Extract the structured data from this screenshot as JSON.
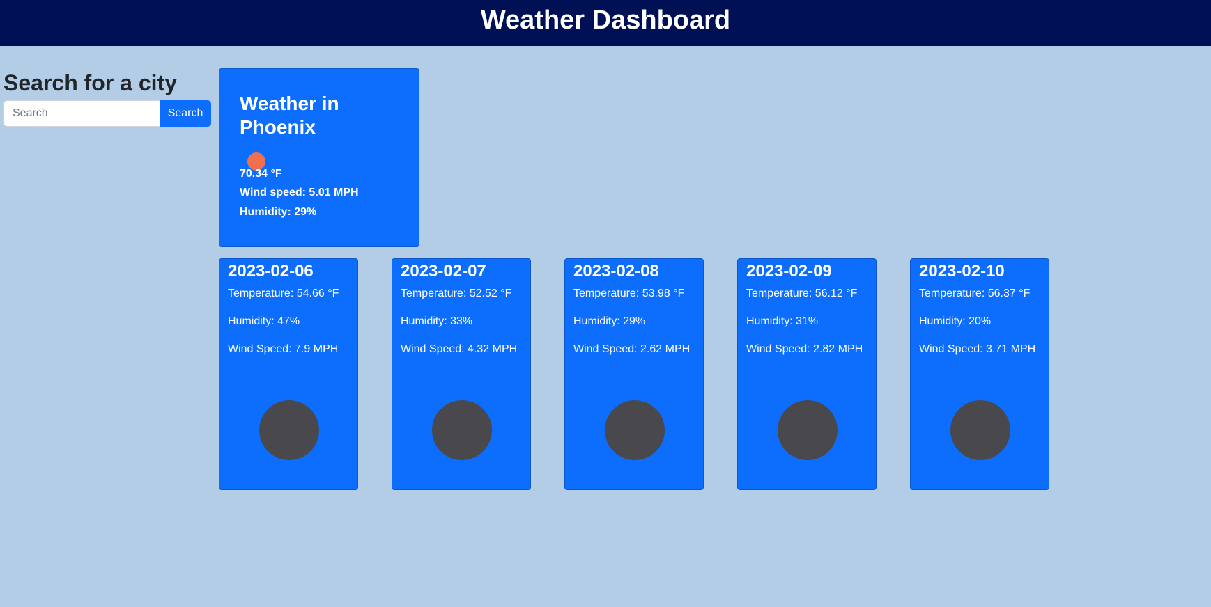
{
  "header": {
    "title": "Weather Dashboard"
  },
  "search": {
    "heading": "Search for a city",
    "placeholder": "Search",
    "value": "",
    "button_label": "Search"
  },
  "current": {
    "title": "Weather in Phoenix",
    "temperature": "70.34 °F",
    "wind": "Wind speed: 5.01 MPH",
    "humidity": "Humidity: 29%",
    "icon": "sun-icon"
  },
  "forecast": [
    {
      "date": "2023-02-06",
      "temperature": "Temperature: 54.66 °F",
      "humidity": "Humidity: 47%",
      "wind": "Wind Speed: 7.9 MPH",
      "icon": "weather-icon"
    },
    {
      "date": "2023-02-07",
      "temperature": "Temperature: 52.52 °F",
      "humidity": "Humidity: 33%",
      "wind": "Wind Speed: 4.32 MPH",
      "icon": "weather-icon"
    },
    {
      "date": "2023-02-08",
      "temperature": "Temperature: 53.98 °F",
      "humidity": "Humidity: 29%",
      "wind": "Wind Speed: 2.62 MPH",
      "icon": "weather-icon"
    },
    {
      "date": "2023-02-09",
      "temperature": "Temperature: 56.12 °F",
      "humidity": "Humidity: 31%",
      "wind": "Wind Speed: 2.82 MPH",
      "icon": "weather-icon"
    },
    {
      "date": "2023-02-10",
      "temperature": "Temperature: 56.37 °F",
      "humidity": "Humidity: 20%",
      "wind": "Wind Speed: 3.71 MPH",
      "icon": "weather-icon"
    }
  ],
  "colors": {
    "page_background": "#b3cde6",
    "header_background": "#001055",
    "card_background": "#0d6efd",
    "sun_icon": "#ef7050",
    "forecast_icon": "#48484d"
  }
}
